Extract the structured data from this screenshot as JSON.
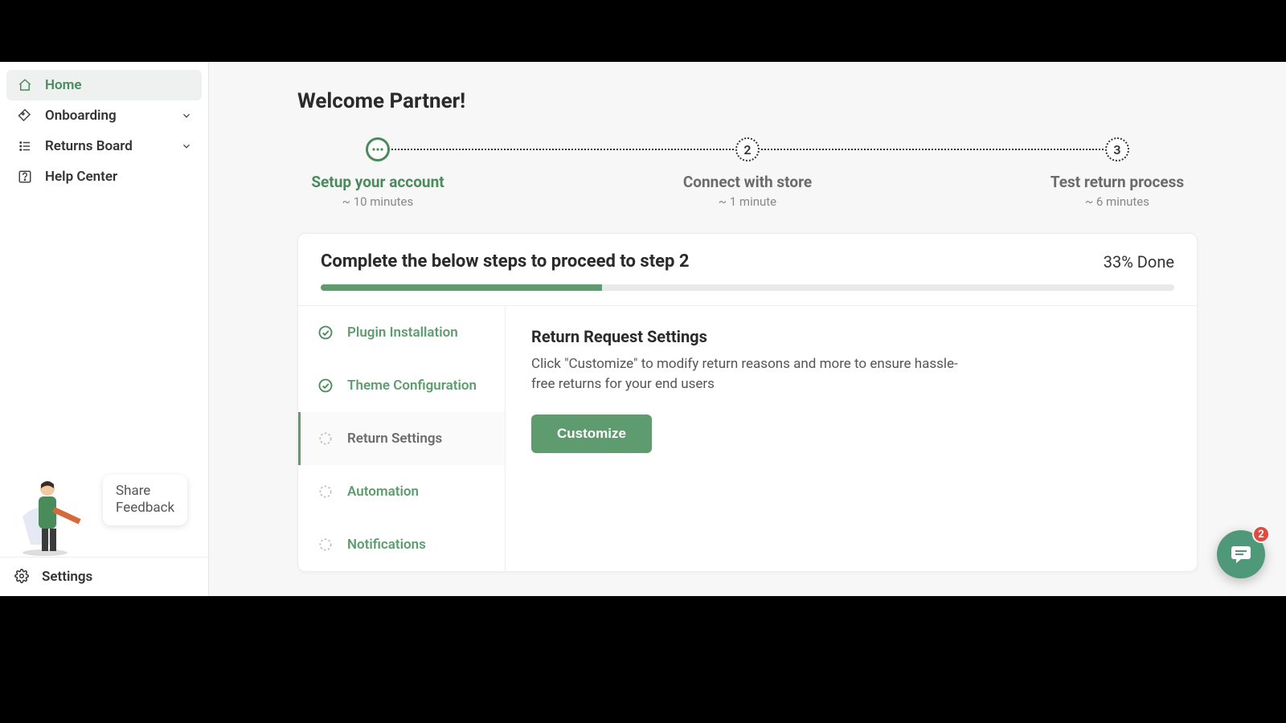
{
  "sidebar": {
    "items": [
      {
        "label": "Home",
        "icon": "home-icon",
        "active": true,
        "expandable": false
      },
      {
        "label": "Onboarding",
        "icon": "tag-icon",
        "active": false,
        "expandable": true
      },
      {
        "label": "Returns Board",
        "icon": "list-icon",
        "active": false,
        "expandable": true
      },
      {
        "label": "Help Center",
        "icon": "help-icon",
        "active": false,
        "expandable": false
      }
    ],
    "feedback_line1": "Share",
    "feedback_line2": "Feedback",
    "settings_label": "Settings"
  },
  "header": {
    "welcome": "Welcome Partner!"
  },
  "stepper": {
    "steps": [
      {
        "num": "···",
        "label": "Setup your account",
        "sub": "~ 10 minutes",
        "state": "active"
      },
      {
        "num": "2",
        "label": "Connect with store",
        "sub": "~ 1 minute",
        "state": "pending"
      },
      {
        "num": "3",
        "label": "Test return process",
        "sub": "~ 6 minutes",
        "state": "pending"
      }
    ]
  },
  "card": {
    "title": "Complete the below steps to proceed to step 2",
    "done_label": "33% Done",
    "progress_pct": 33,
    "list": [
      {
        "label": "Plugin Installation",
        "status": "done"
      },
      {
        "label": "Theme Configuration",
        "status": "done"
      },
      {
        "label": "Return Settings",
        "status": "current"
      },
      {
        "label": "Automation",
        "status": "todo"
      },
      {
        "label": "Notifications",
        "status": "todo"
      }
    ],
    "detail": {
      "title": "Return Request Settings",
      "desc": "Click \"Customize\" to modify return reasons and more to ensure hassle-free returns for your end users",
      "button": "Customize"
    }
  },
  "chat": {
    "badge": "2"
  },
  "colors": {
    "accent": "#5e9c6f"
  }
}
